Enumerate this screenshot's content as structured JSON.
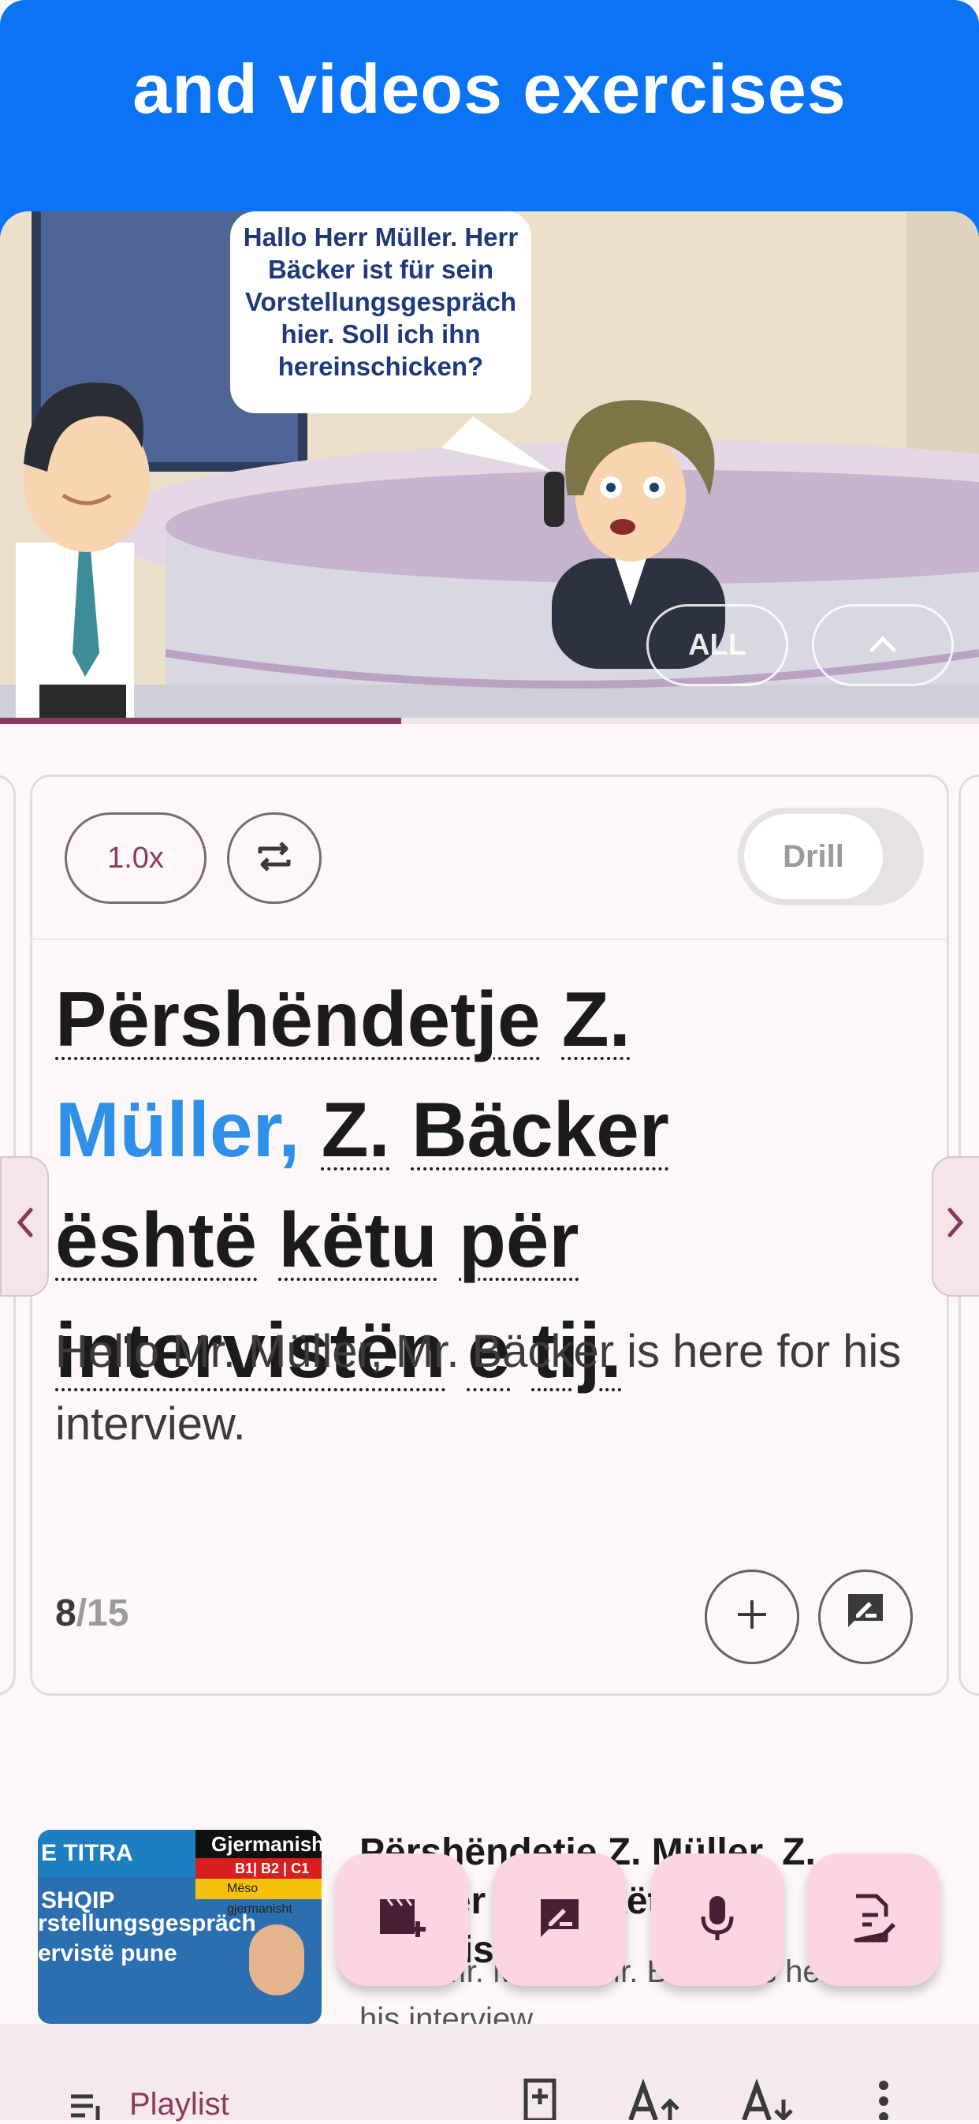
{
  "banner": {
    "title": "and videos exercises"
  },
  "video": {
    "speech_bubble": "Hallo Herr Müller. Herr Bäcker ist für sein Vorstellungsgespräch hier. Soll ich ihn hereinschicken?",
    "all_button": "ALL",
    "collapse_icon": "chevron-up-icon",
    "progress": 0.41
  },
  "card": {
    "speed_label": "1.0x",
    "repeat_icon": "repeat-icon",
    "drill_label": "Drill",
    "drill_on": false,
    "sentence_words": [
      {
        "text": "Përshëndetje",
        "highlight": false
      },
      {
        "text": "Z.",
        "highlight": false
      },
      {
        "text": "Müller,",
        "highlight": true
      },
      {
        "text": "Z.",
        "highlight": false
      },
      {
        "text": "Bäcker",
        "highlight": false
      },
      {
        "text": "është",
        "highlight": false
      },
      {
        "text": "këtu",
        "highlight": false
      },
      {
        "text": "për",
        "highlight": false
      },
      {
        "text": "intervistën",
        "highlight": false
      },
      {
        "text": "e",
        "highlight": false
      },
      {
        "text": "tij.",
        "highlight": false
      }
    ],
    "translation": "Hello Mr. Müller, Mr. Bäcker is here for his interview.",
    "counter_current": "8",
    "counter_total": "/15",
    "add_icon": "plus-icon",
    "note_icon": "note-edit-icon"
  },
  "nav": {
    "prev_icon": "chevron-left-icon",
    "next_icon": "chevron-right-icon"
  },
  "playlist_item": {
    "thumb_top": "E TITRA SHQIP",
    "thumb_flag_title": "Gjermanisht",
    "thumb_levels": "B1| B2 | C1",
    "thumb_flag_sub": "Mëso gjermanisht",
    "thumb_text": "rstellungsgespräch ervistë pune",
    "title": "Përshëndetje Z. Müller, Z. Bäcker është këtu për intervistën",
    "subtitle": "Hello Mr. Müller, Mr. Bäcker is here for his interview"
  },
  "fabs": [
    {
      "icon": "video-add-icon"
    },
    {
      "icon": "comment-edit-icon"
    },
    {
      "icon": "microphone-icon"
    },
    {
      "icon": "document-edit-icon"
    }
  ],
  "bottom_bar": {
    "playlist_label": "Playlist",
    "icons": [
      "bookmark-add-icon",
      "font-increase-icon",
      "font-decrease-icon",
      "more-vert-icon"
    ]
  },
  "colors": {
    "banner": "#0a74f4",
    "accent": "#8b3a5e",
    "highlight": "#2e90e8",
    "fab": "#fbd6e2"
  }
}
